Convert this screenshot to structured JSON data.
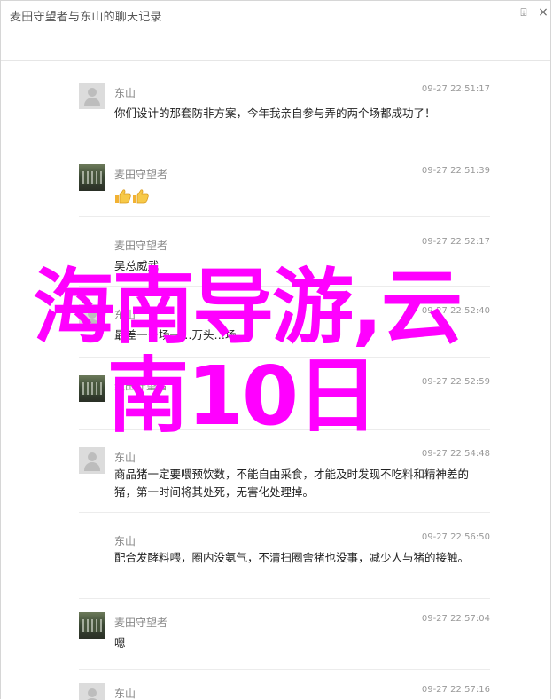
{
  "window": {
    "title": "麦田守望者与东山的聊天记录",
    "pin_icon": "pin-icon",
    "close_icon": "close-icon"
  },
  "messages": [
    {
      "sender": "东山",
      "time": "09-27 22:51:17",
      "text": "你们设计的那套防非方案，今年我亲自参与弄的两个场都成功了！",
      "avatar": "default-avatar"
    },
    {
      "sender": "麦田守望者",
      "time": "09-27 22:51:39",
      "text": "",
      "emoji": "thumbs-up x2",
      "avatar": "photo-avatar"
    },
    {
      "sender": "麦田守望者",
      "time": "09-27 22:52:17",
      "text": "吴总威武",
      "avatar": "none"
    },
    {
      "sender": "东山",
      "time": "09-27 22:52:40",
      "text": "最差一个场一…万头…场…",
      "avatar": "default-avatar"
    },
    {
      "sender": "麦田守望者",
      "time": "09-27 22:52:59",
      "text": "",
      "avatar": "photo-avatar"
    },
    {
      "sender": "东山",
      "time": "09-27 22:54:48",
      "text": "商品猪一定要喂预饮数，不能自由采食，才能及时发现不吃料和精神差的猪，第一时间将其处死，无害化处理掉。",
      "avatar": "default-avatar"
    },
    {
      "sender": "东山",
      "time": "09-27 22:56:50",
      "text": "配合发酵料喂，圈内没氨气，不清扫圈舍猪也没事，减少人与猪的接触。",
      "avatar": "none"
    },
    {
      "sender": "麦田守望者",
      "time": "09-27 22:57:04",
      "text": "嗯",
      "avatar": "photo-avatar"
    },
    {
      "sender": "东山",
      "time": "09-27 22:57:16",
      "text": "",
      "avatar": "default-avatar"
    }
  ],
  "watermark": {
    "line1": "海南导游,云",
    "line2": "南10日"
  }
}
